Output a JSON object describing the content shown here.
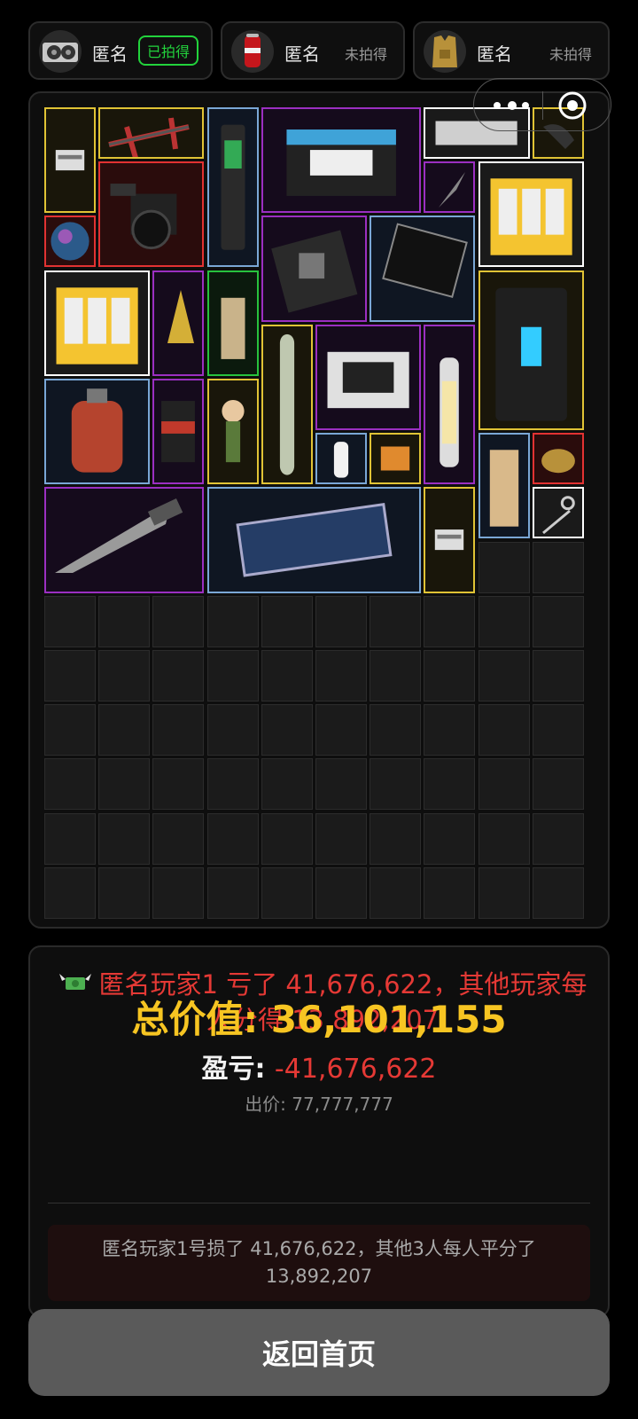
{
  "players": [
    {
      "name": "匿名",
      "status": "已拍得",
      "won": true,
      "avatar": "graphics-card-icon"
    },
    {
      "name": "匿名",
      "status": "未拍得",
      "won": false,
      "avatar": "cola-can-icon"
    },
    {
      "name": "匿名",
      "status": "未拍得",
      "won": false,
      "avatar": "golden-vest-icon"
    }
  ],
  "capsule": {
    "more": "more-dots-icon",
    "close": "target-close-icon"
  },
  "items": [
    {
      "name": "document-scrap",
      "rarity": "gold"
    },
    {
      "name": "compound-crossbow",
      "rarity": "gold"
    },
    {
      "name": "voice-recorder",
      "rarity": "blue"
    },
    {
      "name": "car-battery",
      "rarity": "purple"
    },
    {
      "name": "rolled-map",
      "rarity": "white"
    },
    {
      "name": "game-controller",
      "rarity": "gold"
    },
    {
      "name": "film-camera-rig",
      "rarity": "red"
    },
    {
      "name": "spear-head",
      "rarity": "purple"
    },
    {
      "name": "candle-pack",
      "rarity": "white"
    },
    {
      "name": "iridescent-orb",
      "rarity": "red"
    },
    {
      "name": "motherboard",
      "rarity": "purple"
    },
    {
      "name": "lcd-panel",
      "rarity": "blue"
    },
    {
      "name": "candle-pack",
      "rarity": "white"
    },
    {
      "name": "ornate-dagger-tip",
      "rarity": "purple"
    },
    {
      "name": "coffee-bag",
      "rarity": "green"
    },
    {
      "name": "power-station",
      "rarity": "gold"
    },
    {
      "name": "drawing-tube",
      "rarity": "gold"
    },
    {
      "name": "lab-incubator",
      "rarity": "purple"
    },
    {
      "name": "camping-lantern",
      "rarity": "purple"
    },
    {
      "name": "gas-cylinder",
      "rarity": "blue"
    },
    {
      "name": "snack-pack",
      "rarity": "purple"
    },
    {
      "name": "boy-figurine",
      "rarity": "gold"
    },
    {
      "name": "medicine-bottle",
      "rarity": "blue"
    },
    {
      "name": "pill-blister",
      "rarity": "gold"
    },
    {
      "name": "clipboard",
      "rarity": "blue"
    },
    {
      "name": "caviar-tin",
      "rarity": "red"
    },
    {
      "name": "scissors",
      "rarity": "white"
    },
    {
      "name": "hunting-knife",
      "rarity": "purple"
    },
    {
      "name": "solar-panel",
      "rarity": "blue"
    },
    {
      "name": "document-scrap",
      "rarity": "gold"
    }
  ],
  "result": {
    "loss_message": "匿名玩家1 亏了 41,676,622，其他玩家每人分得 13,892,207",
    "total_value": "总价值: 36,101,155",
    "profit_label": "盈亏: ",
    "profit_value": "-41,676,622",
    "bid": "出价: 77,777,777",
    "summary": "匿名玩家1号损了 41,676,622，其他3人每人平分了 13,892,207"
  },
  "home_button": "返回首页",
  "colors": {
    "gold": "#e0c335",
    "purple": "#9b2fc1",
    "red": "#e23232",
    "blue": "#7aa7d6",
    "green": "#27c23d",
    "white": "#ffffff",
    "loss": "#e53935",
    "total": "#f7c522"
  }
}
